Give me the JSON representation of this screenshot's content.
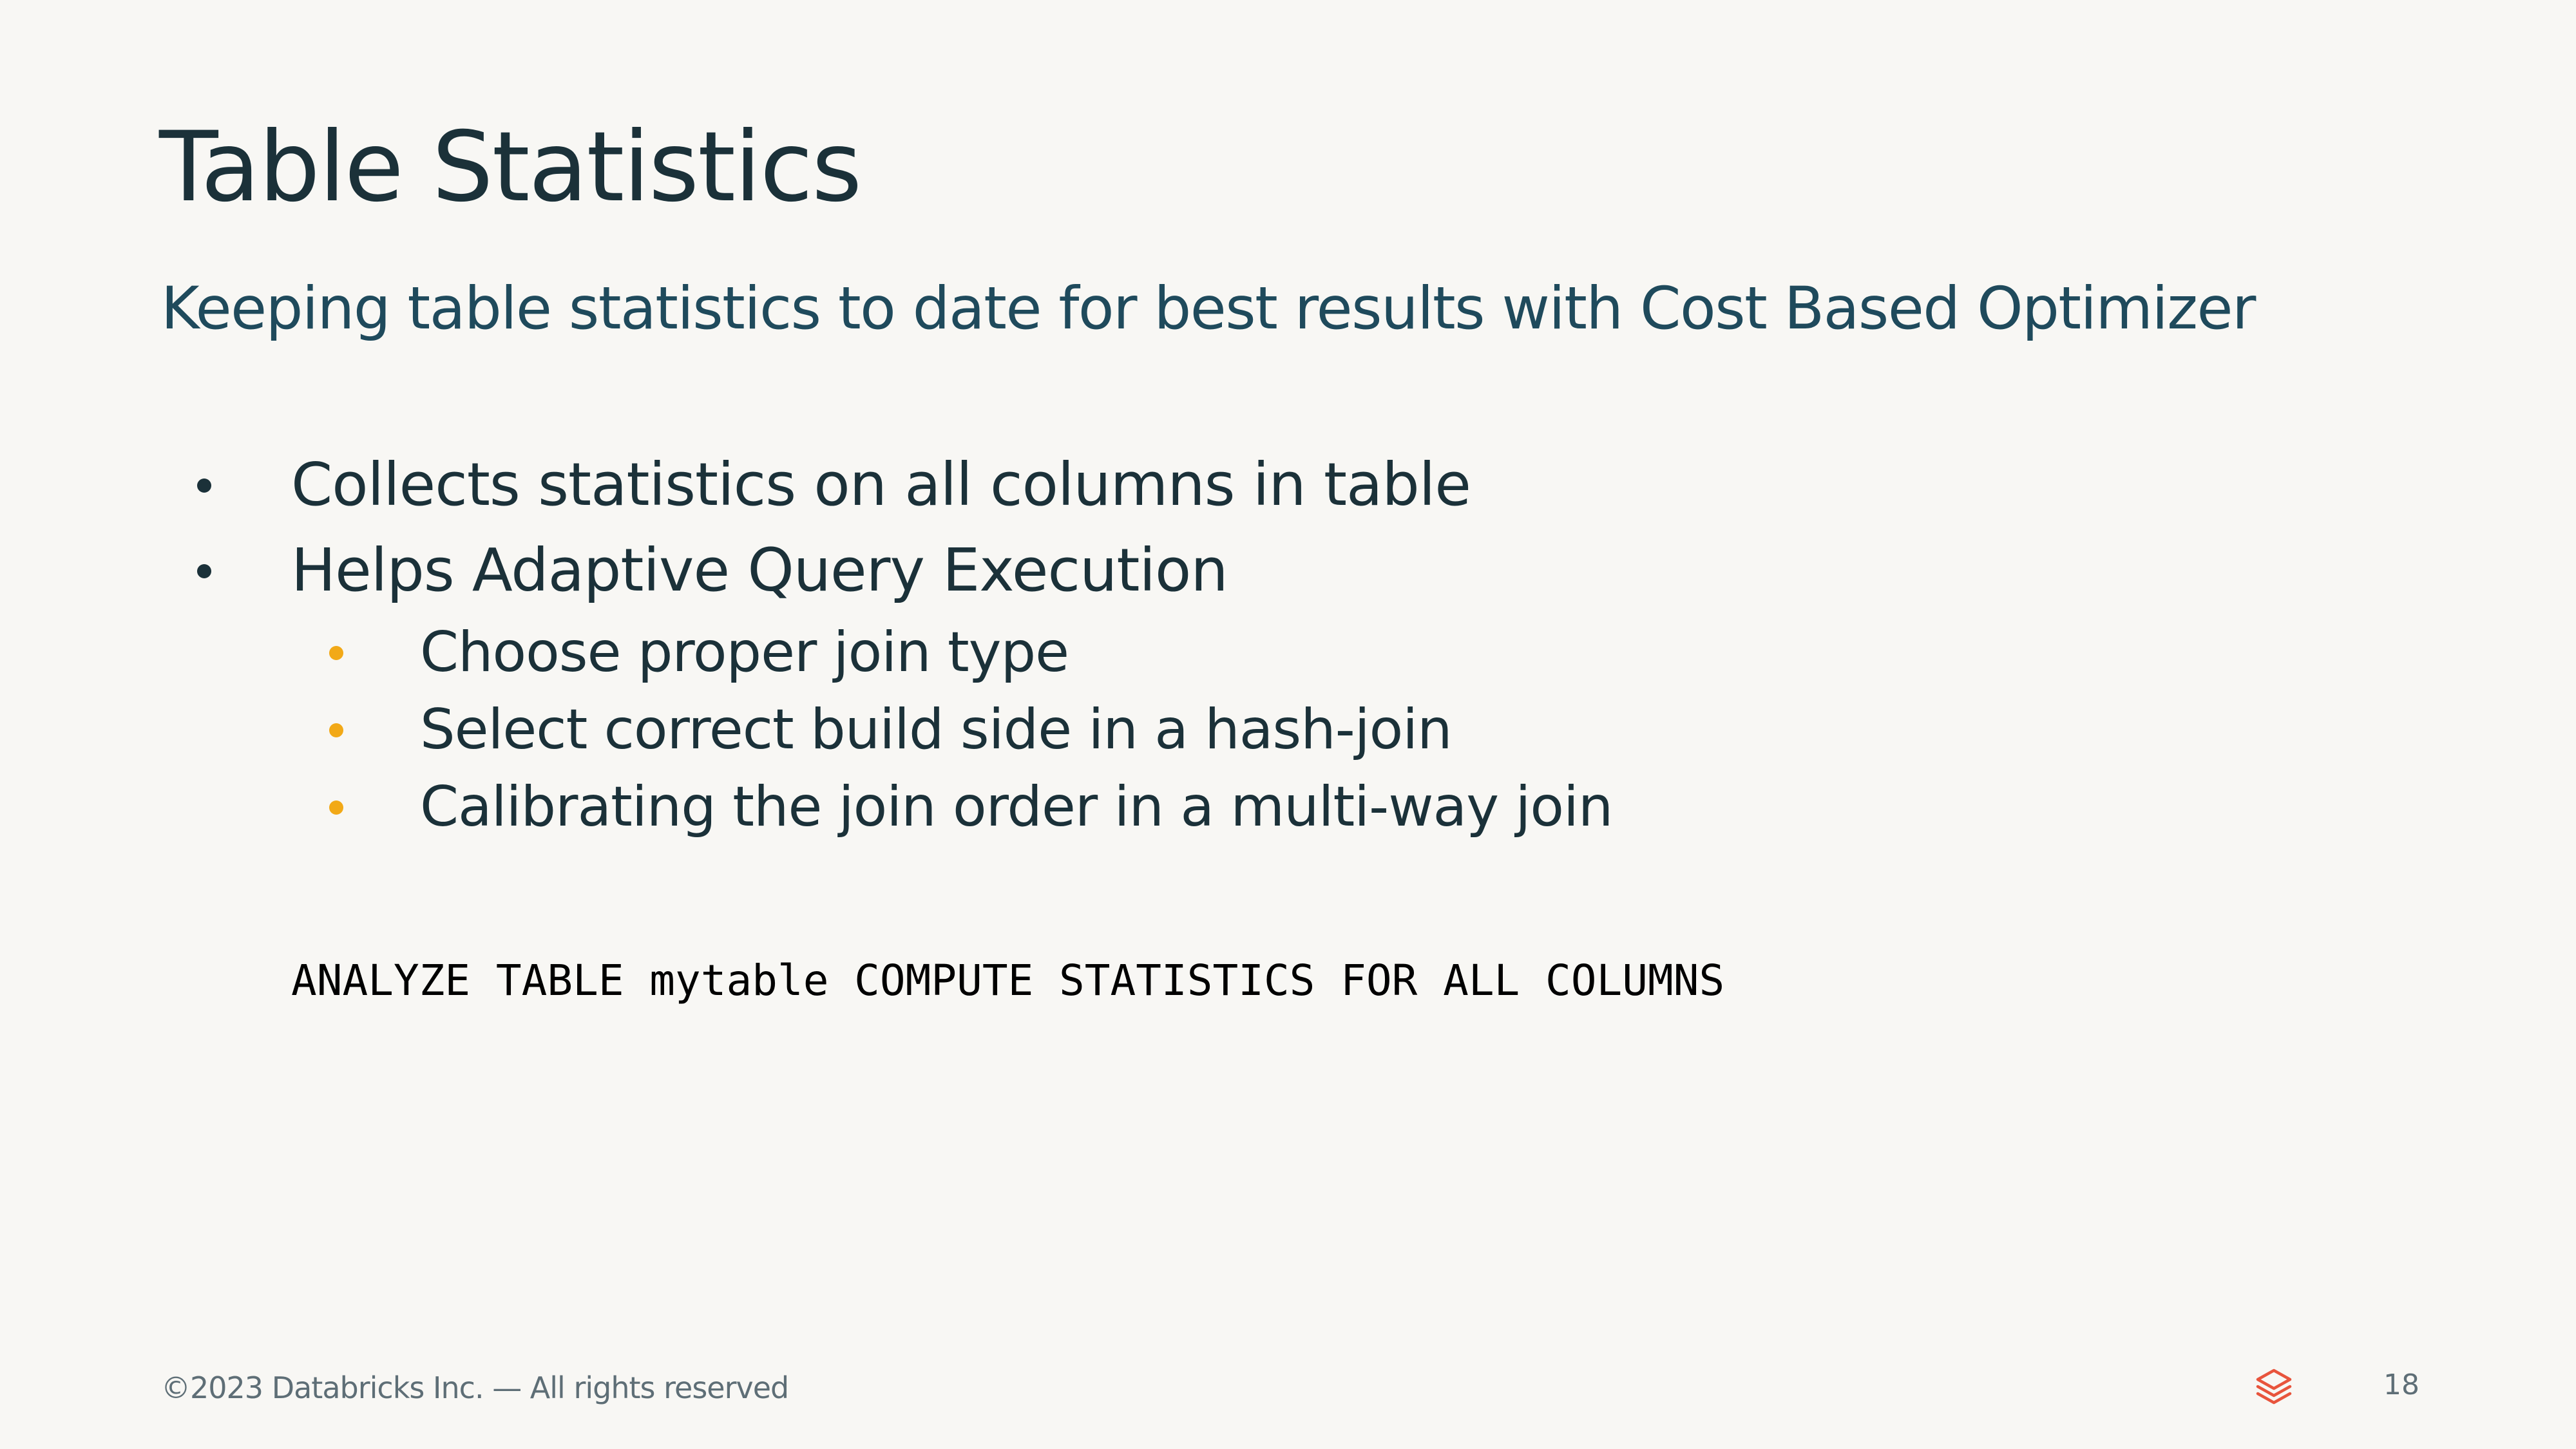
{
  "slide": {
    "title": "Table Statistics",
    "subtitle": "Keeping table statistics to date for best results with Cost Based Optimizer",
    "bullets": [
      {
        "text": "Collects statistics on all columns in table",
        "level": 1
      },
      {
        "text": "Helps Adaptive Query Execution",
        "level": 1
      },
      {
        "text": "Choose proper join type",
        "level": 2
      },
      {
        "text": "Select correct build side in a hash-join",
        "level": 2
      },
      {
        "text": "Calibrating the join order in a multi-way join",
        "level": 2
      }
    ],
    "code": "ANALYZE TABLE mytable COMPUTE STATISTICS FOR ALL COLUMNS"
  },
  "footer": {
    "copyright": "©2023 Databricks Inc. — All rights reserved",
    "page_number": "18",
    "logo_icon": "databricks-logo-icon"
  },
  "colors": {
    "background": "#F8F7F4",
    "title": "#1B3139",
    "subtitle": "#1F4A5C",
    "sub_bullet_accent": "#F2A917",
    "logo": "#E8543C",
    "footer_text": "#5E6E76"
  }
}
